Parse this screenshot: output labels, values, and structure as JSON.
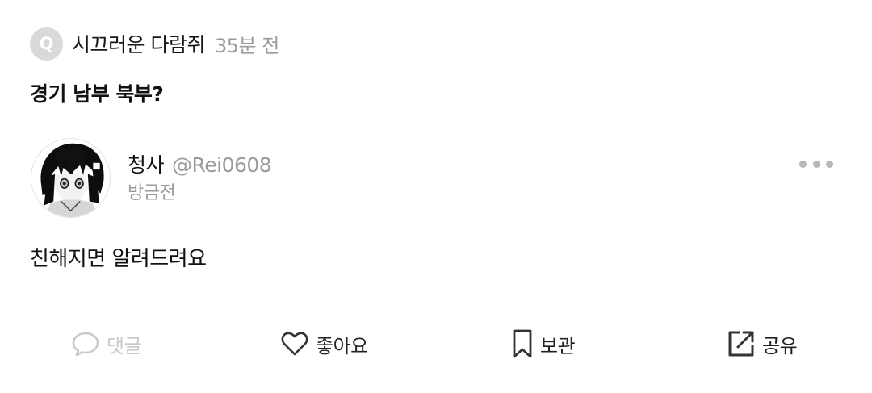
{
  "question": {
    "badge_letter": "Q",
    "author": "시끄러운 다람쥐",
    "time": "35분 전",
    "text": "경기 남부 북부?"
  },
  "answer": {
    "name": "청사",
    "handle": "@Rei0608",
    "time": "방금전",
    "text": "친해지면 알려드려요",
    "avatar_icon": "anime-character-avatar"
  },
  "actions": {
    "comment_label": "댓글",
    "like_label": "좋아요",
    "save_label": "보관",
    "share_label": "공유"
  },
  "colors": {
    "muted_text": "#9b9b9b",
    "disabled_action": "#c9c9c9",
    "badge_bg": "#d9d9d9"
  }
}
